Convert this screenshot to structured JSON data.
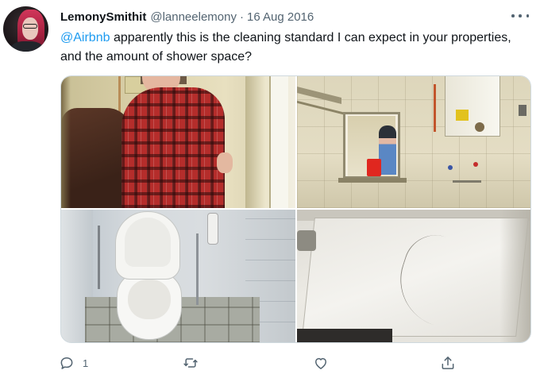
{
  "tweet": {
    "author": {
      "display_name": "LemonySmithit",
      "handle": "@lanneelemony",
      "date": "16 Aug 2016",
      "separator": "·"
    },
    "text": {
      "mention": "@Airbnb",
      "body": " apparently this is the cleaning standard I can expect in your properties, and the amount of shower space?"
    },
    "media": {
      "photo_count": 4
    },
    "actions": {
      "reply_count": "1",
      "retweet_count": "",
      "like_count": ""
    },
    "icons": {
      "more": "more-horizontal-icon",
      "reply": "reply-bubble-icon",
      "retweet": "retweet-icon",
      "like": "heart-icon",
      "share": "share-upload-icon"
    },
    "colors": {
      "accent": "#1d9bf0",
      "secondary_text": "#536471",
      "primary_text": "#0f1419"
    }
  }
}
